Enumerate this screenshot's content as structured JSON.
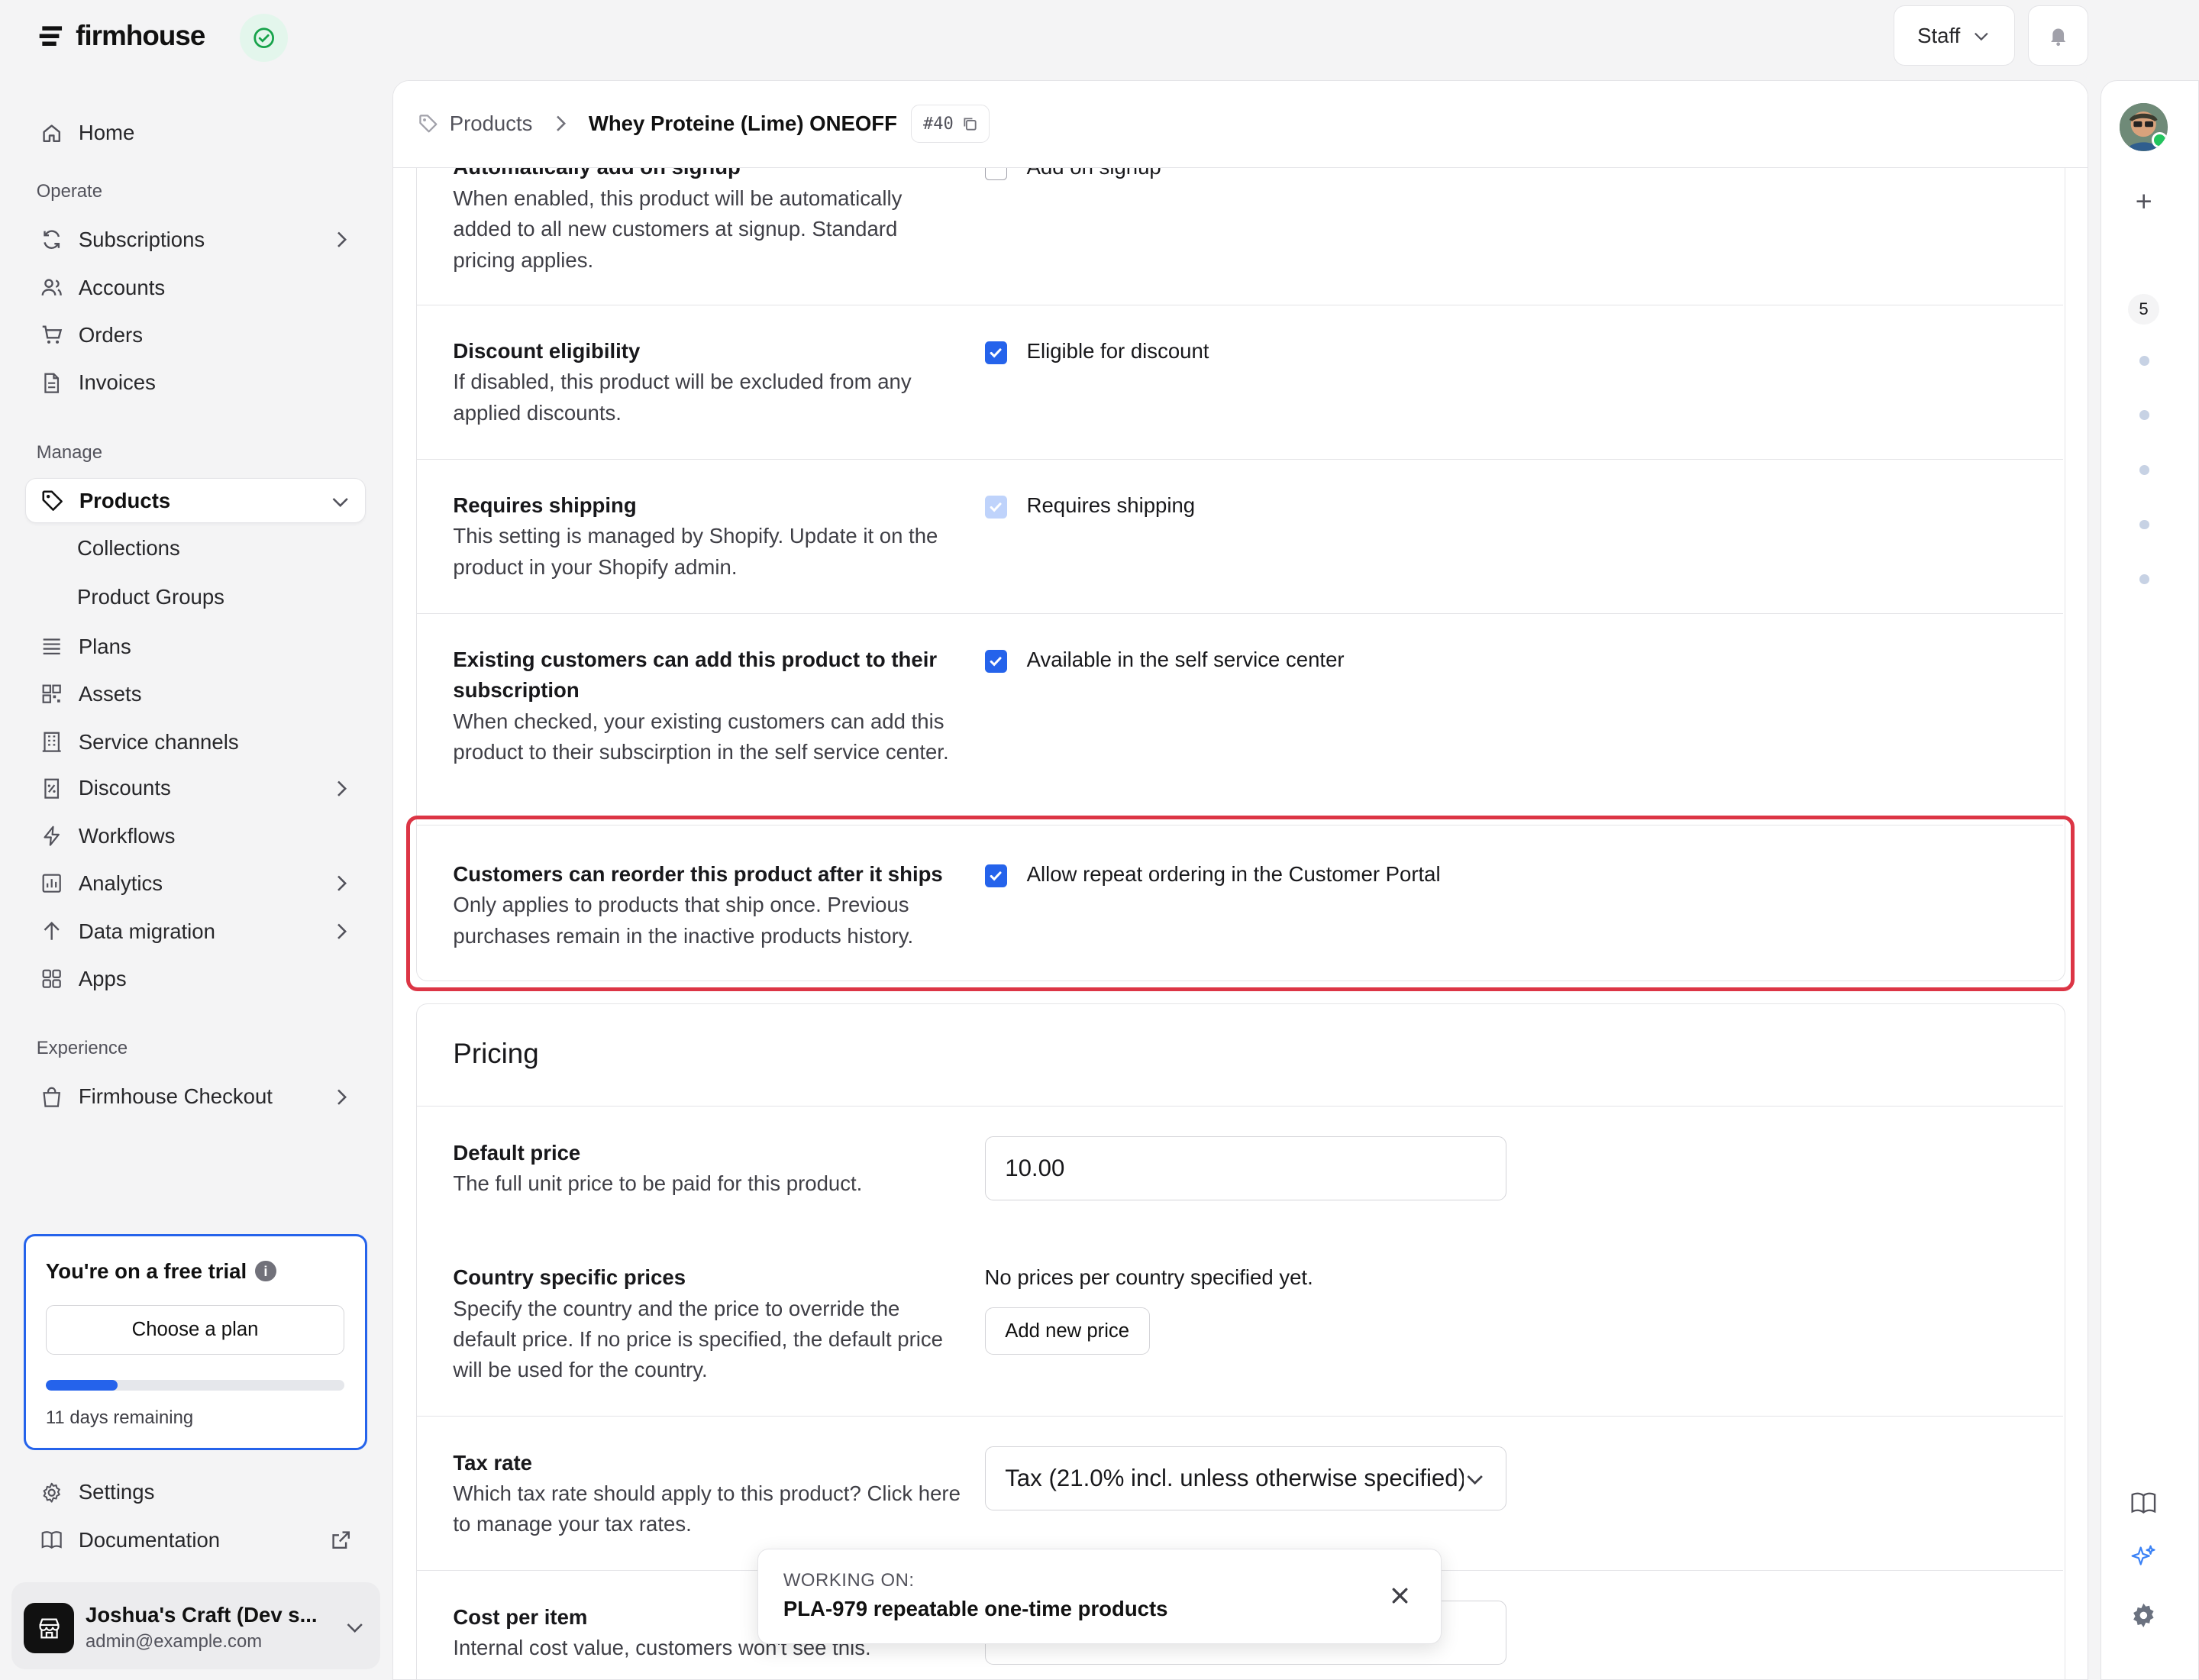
{
  "app": {
    "name": "firmhouse"
  },
  "sidebar": {
    "home": "Home",
    "operate_heading": "Operate",
    "operate": [
      "Subscriptions",
      "Accounts",
      "Orders",
      "Invoices"
    ],
    "manage_heading": "Manage",
    "products": "Products",
    "products_sub": [
      "Collections",
      "Product Groups"
    ],
    "manage": [
      "Plans",
      "Assets",
      "Service channels",
      "Discounts",
      "Workflows",
      "Analytics",
      "Data migration",
      "Apps"
    ],
    "experience_heading": "Experience",
    "checkout": "Firmhouse Checkout",
    "settings": "Settings",
    "documentation": "Documentation"
  },
  "trial": {
    "title": "You're on a free trial",
    "info_glyph": "i",
    "button": "Choose a plan",
    "progress": 0.24,
    "remaining": "11 days remaining"
  },
  "account": {
    "name": "Joshua's Craft (Dev s...",
    "email": "admin@example.com"
  },
  "topbar": {
    "staff": "Staff"
  },
  "breadcrumb": {
    "parent": "Products",
    "current": "Whey Proteine (Lime) ONEOFF",
    "id": "#40"
  },
  "settings_rows": {
    "signup": {
      "title": "Automatically add on signup",
      "desc": "When enabled, this product will be automatically added to all new customers at signup. Standard pricing applies.",
      "label": "Add on signup"
    },
    "discount": {
      "title": "Discount eligibility",
      "desc": "If disabled, this product will be excluded from any applied discounts.",
      "label": "Eligible for discount"
    },
    "shipping": {
      "title": "Requires shipping",
      "desc": "This setting is managed by Shopify. Update it on the product in your Shopify admin.",
      "label": "Requires shipping"
    },
    "selfservice": {
      "title": "Existing customers can add this product to their subscription",
      "desc": "When checked, your existing customers can add this product to their subscirption in the self service center.",
      "label": "Available in the self service center"
    },
    "reorder": {
      "title": "Customers can reorder this product after it ships",
      "desc": "Only applies to products that ship once. Previous purchases remain in the inactive products history.",
      "label": "Allow repeat ordering in the Customer Portal"
    }
  },
  "pricing": {
    "heading": "Pricing",
    "default_price": {
      "title": "Default price",
      "desc": "The full unit price to be paid for this product.",
      "value": "10.00"
    },
    "country": {
      "title": "Country specific prices",
      "desc": "Specify the country and the price to override the default price. If no price is specified, the default price will be used for the country.",
      "empty": "No prices per country specified yet.",
      "button": "Add new price"
    },
    "tax": {
      "title": "Tax rate",
      "desc": "Which tax rate should apply to this product? Click here to manage your tax rates.",
      "value": "Tax (21.0% incl. unless otherwise specified)"
    },
    "cost": {
      "title": "Cost per item",
      "desc": "Internal cost value, customers won't see this."
    }
  },
  "toast": {
    "label": "WORKING ON:",
    "text": "PLA-979 repeatable one-time products"
  },
  "rail": {
    "count": "5"
  },
  "colors": {
    "accent": "#2563eb",
    "highlight": "#dc3545",
    "success": "#22c55e"
  }
}
